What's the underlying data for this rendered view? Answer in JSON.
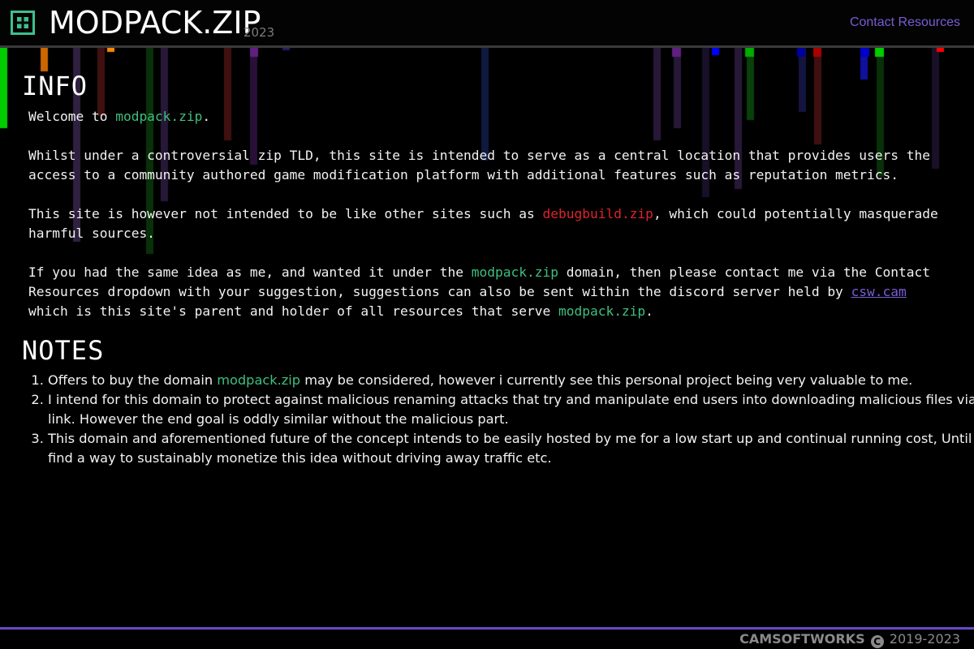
{
  "header": {
    "title": "MODPACK.ZIP",
    "year": "2023",
    "logo_icon": "grid-square-icon",
    "contact_label": "Contact Resources"
  },
  "info": {
    "heading": "INFO",
    "p1": {
      "before": "Welcome to ",
      "link": "modpack.zip",
      "after": "."
    },
    "p2": "Whilst under a controversial zip TLD, this site is intended to serve as a central location that provides users the access to a community authored game modification platform with additional features such as reputation metrics.",
    "p3": {
      "before": "This site is however not intended to be like other sites such as ",
      "link": "debugbuild.zip",
      "after": ", which could potentially masquerade harmful sources."
    },
    "p4": {
      "t1": "If you had the same idea as me, and wanted it under the ",
      "link1": "modpack.zip",
      "t2": " domain, then please contact me via the Contact Resources dropdown with your suggestion, suggestions can also be sent within the discord server held by ",
      "link2": "csw.cam",
      "t3": " which is this site's parent and holder of all resources that serve ",
      "link3": "modpack.zip",
      "t4": "."
    }
  },
  "notes": {
    "heading": "NOTES",
    "items": [
      {
        "before": "Offers to buy the domain ",
        "link": "modpack.zip",
        "after": " may be considered, however i currently see this personal project being very valuable to me."
      },
      {
        "before": "I intend for this domain to protect against malicious renaming attacks that try and manipulate end users into downloading malicious files via a link. However the end goal is oddly similar without the malicious part.",
        "link": "",
        "after": ""
      },
      {
        "before": "This domain and aforementioned future of the concept intends to be easily hosted by me for a low start up and continual running cost, Until i find a way to sustainably monetize this idea without driving away traffic etc.",
        "link": "",
        "after": ""
      }
    ]
  },
  "footer": {
    "brand": "CAMSOFTWORKS",
    "copyright_icon": "copyright-icon",
    "copyright_symbol": "C",
    "years": "2019-2023"
  },
  "colors": {
    "accent_purple": "#6a47c8",
    "link_green": "#3fbf7f",
    "link_red": "#e0222c",
    "logo_green": "#3fbf8f"
  }
}
